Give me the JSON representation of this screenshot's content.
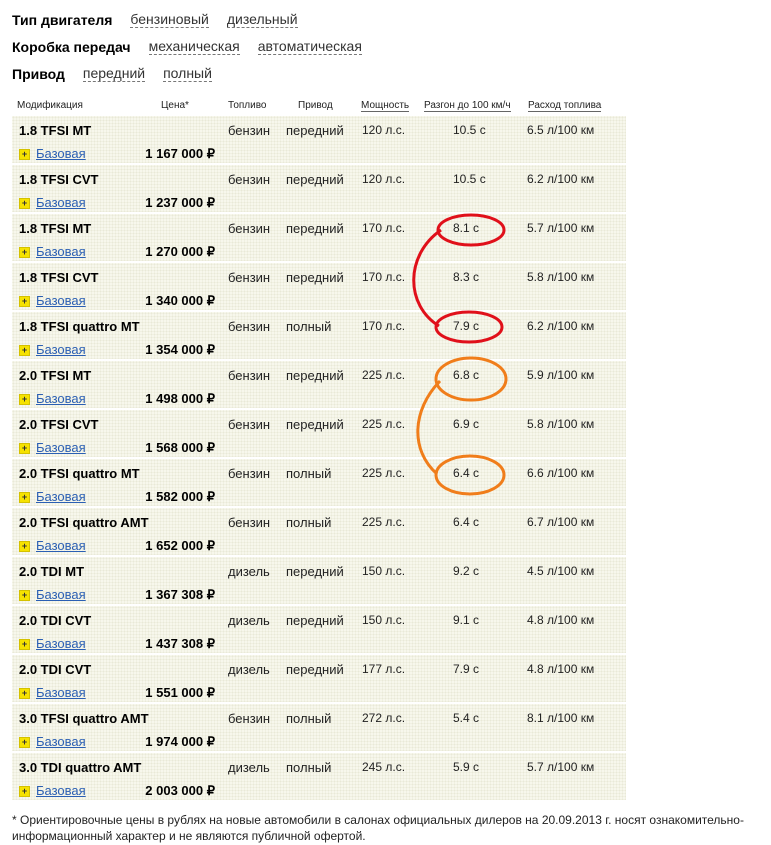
{
  "filters": [
    {
      "label": "Тип двигателя",
      "options": [
        "бензиновый",
        "дизельный"
      ]
    },
    {
      "label": "Коробка передач",
      "options": [
        "механическая",
        "автоматическая"
      ]
    },
    {
      "label": "Привод",
      "options": [
        "передний",
        "полный"
      ]
    }
  ],
  "headers": {
    "mod": "Модификация",
    "price": "Цена*",
    "fuel": "Топливо",
    "drive": "Привод",
    "power": "Мощность",
    "accel": "Разгон до 100 км/ч",
    "cons": "Расход топлива"
  },
  "rows": [
    {
      "name": "1.8 TFSI MT",
      "trim": "Базовая",
      "price": "1 167 000 ₽",
      "fuel": "бензин",
      "drive": "передний",
      "power": "120 л.с.",
      "accel": "10.5 с",
      "cons": "6.5 л/100 км"
    },
    {
      "name": "1.8 TFSI CVT",
      "trim": "Базовая",
      "price": "1 237 000 ₽",
      "fuel": "бензин",
      "drive": "передний",
      "power": "120 л.с.",
      "accel": "10.5 с",
      "cons": "6.2 л/100 км"
    },
    {
      "name": "1.8 TFSI MT",
      "trim": "Базовая",
      "price": "1 270 000 ₽",
      "fuel": "бензин",
      "drive": "передний",
      "power": "170 л.с.",
      "accel": "8.1 с",
      "cons": "5.7 л/100 км"
    },
    {
      "name": "1.8 TFSI CVT",
      "trim": "Базовая",
      "price": "1 340 000 ₽",
      "fuel": "бензин",
      "drive": "передний",
      "power": "170 л.с.",
      "accel": "8.3 с",
      "cons": "5.8 л/100 км"
    },
    {
      "name": "1.8 TFSI quattro MT",
      "trim": "Базовая",
      "price": "1 354 000 ₽",
      "fuel": "бензин",
      "drive": "полный",
      "power": "170 л.с.",
      "accel": "7.9 с",
      "cons": "6.2 л/100 км"
    },
    {
      "name": "2.0 TFSI MT",
      "trim": "Базовая",
      "price": "1 498 000 ₽",
      "fuel": "бензин",
      "drive": "передний",
      "power": "225 л.с.",
      "accel": "6.8 с",
      "cons": "5.9 л/100 км"
    },
    {
      "name": "2.0 TFSI CVT",
      "trim": "Базовая",
      "price": "1 568 000 ₽",
      "fuel": "бензин",
      "drive": "передний",
      "power": "225 л.с.",
      "accel": "6.9 с",
      "cons": "5.8 л/100 км"
    },
    {
      "name": "2.0 TFSI quattro MT",
      "trim": "Базовая",
      "price": "1 582 000 ₽",
      "fuel": "бензин",
      "drive": "полный",
      "power": "225 л.с.",
      "accel": "6.4 с",
      "cons": "6.6 л/100 км"
    },
    {
      "name": "2.0 TFSI quattro AMT",
      "trim": "Базовая",
      "price": "1 652 000 ₽",
      "fuel": "бензин",
      "drive": "полный",
      "power": "225 л.с.",
      "accel": "6.4 с",
      "cons": "6.7 л/100 км"
    },
    {
      "name": "2.0 TDI MT",
      "trim": "Базовая",
      "price": "1 367 308 ₽",
      "fuel": "дизель",
      "drive": "передний",
      "power": "150 л.с.",
      "accel": "9.2 с",
      "cons": "4.5 л/100 км"
    },
    {
      "name": "2.0 TDI CVT",
      "trim": "Базовая",
      "price": "1 437 308 ₽",
      "fuel": "дизель",
      "drive": "передний",
      "power": "150 л.с.",
      "accel": "9.1 с",
      "cons": "4.8 л/100 км"
    },
    {
      "name": "2.0 TDI CVT",
      "trim": "Базовая",
      "price": "1 551 000 ₽",
      "fuel": "дизель",
      "drive": "передний",
      "power": "177 л.с.",
      "accel": "7.9 с",
      "cons": "4.8 л/100 км"
    },
    {
      "name": "3.0 TFSI quattro AMT",
      "trim": "Базовая",
      "price": "1 974 000 ₽",
      "fuel": "бензин",
      "drive": "полный",
      "power": "272 л.с.",
      "accel": "5.4 с",
      "cons": "8.1 л/100 км"
    },
    {
      "name": "3.0 TDI quattro AMT",
      "trim": "Базовая",
      "price": "2 003 000 ₽",
      "fuel": "дизель",
      "drive": "полный",
      "power": "245 л.с.",
      "accel": "5.9 с",
      "cons": "5.7 л/100 км"
    }
  ],
  "plus_icon": "+",
  "annotation_colors": {
    "red": "#e0101a",
    "orange": "#f07d1a"
  },
  "footnote": "* Ориентировочные цены в рублях на новые автомобили в салонах официальных дилеров на 20.09.2013 г. носят ознакомительно-информационный характер и не являются публичной офертой."
}
